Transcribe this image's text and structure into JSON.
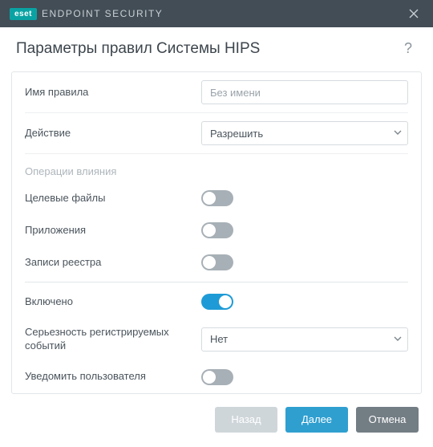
{
  "titlebar": {
    "brand_badge": "eset",
    "brand_text": "ENDPOINT SECURITY"
  },
  "header": {
    "title": "Параметры правил Системы HIPS"
  },
  "form": {
    "rule_name": {
      "label": "Имя правила",
      "placeholder": "Без имени",
      "value": ""
    },
    "action": {
      "label": "Действие",
      "value": "Разрешить"
    },
    "operations_section": "Операции влияния",
    "target_files": {
      "label": "Целевые файлы",
      "on": false
    },
    "applications": {
      "label": "Приложения",
      "on": false
    },
    "registry_entries": {
      "label": "Записи реестра",
      "on": false
    },
    "enabled": {
      "label": "Включено",
      "on": true
    },
    "severity": {
      "label": "Серьезность регистрируемых событий",
      "value": "Нет"
    },
    "notify_user": {
      "label": "Уведомить пользователя",
      "on": false
    }
  },
  "footer": {
    "back": "Назад",
    "next": "Далее",
    "cancel": "Отмена"
  }
}
